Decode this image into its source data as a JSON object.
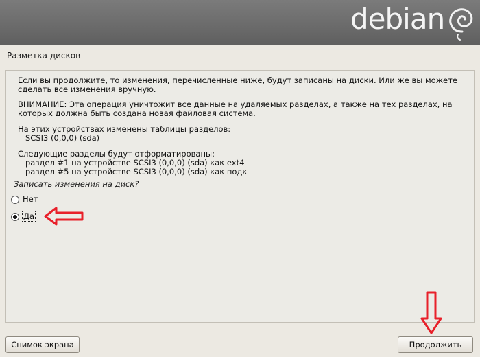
{
  "header": {
    "logo_text": "debian"
  },
  "screen_title": "Разметка дисков",
  "content": {
    "paragraphs": [
      "Если вы продолжите, то изменения, перечисленные ниже, будут записаны на диски. Или же вы можете\nсделать все изменения вручную.",
      "ВНИМАНИЕ: Эта операция уничтожит все данные на удаляемых разделах, а также на тех разделах, на\nкоторых должна быть создана новая файловая система.",
      "На этих устройствах изменены таблицы разделов:\n   SCSI3 (0,0,0) (sda)",
      "Следующие разделы будут отформатированы:\n   раздел #1 на устройстве SCSI3 (0,0,0) (sda) как ext4\n   раздел #5 на устройстве SCSI3 (0,0,0) (sda) как подк"
    ],
    "question": "Записать изменения на диск?",
    "options": [
      {
        "label": "Нет",
        "selected": false
      },
      {
        "label": "Да",
        "selected": true
      }
    ]
  },
  "buttons": {
    "screenshot": "Снимок экрана",
    "continue": "Продолжить"
  },
  "colors": {
    "header_gray": "#6a6a6a",
    "annotation_red": "#e8202a",
    "background": "#ece9e2"
  }
}
